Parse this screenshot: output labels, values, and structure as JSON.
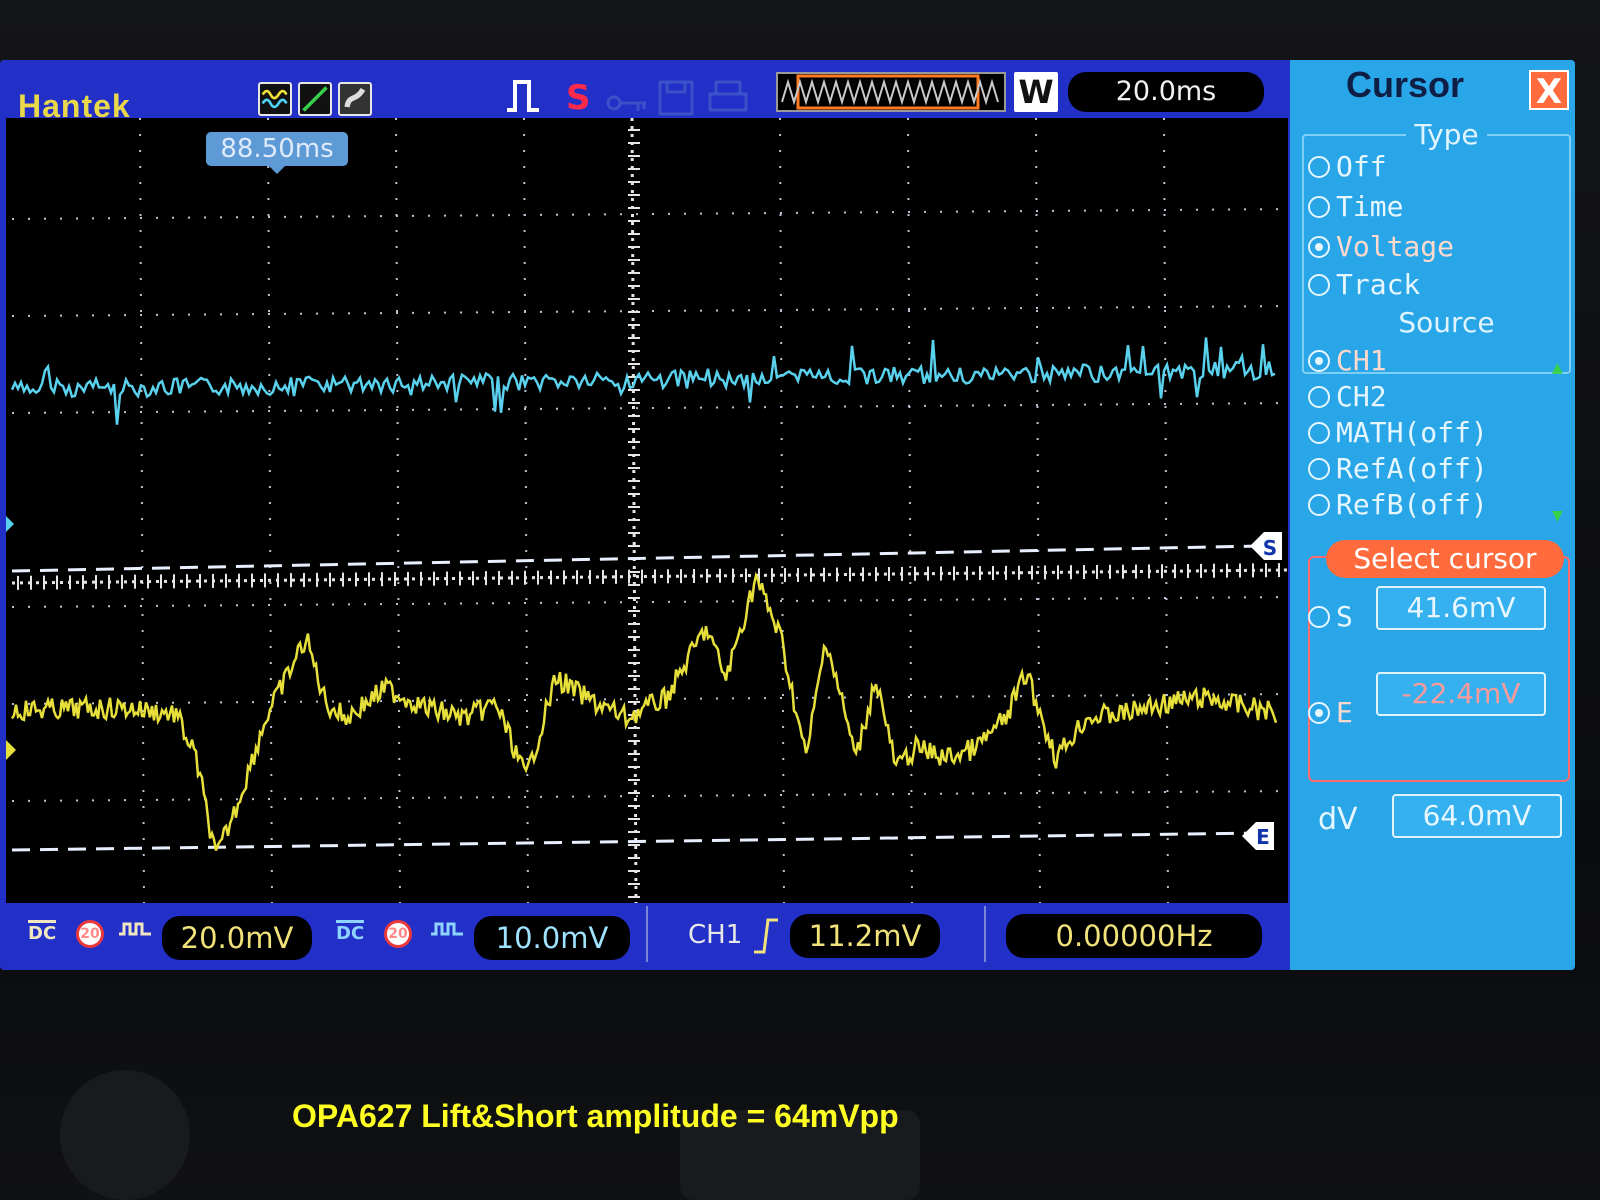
{
  "header": {
    "brand": "Hantek",
    "icons": [
      "wave-mode-icon",
      "line-mode-icon",
      "display-mode-icon",
      "trigger-pulse-icon",
      "stop-icon",
      "key-lock-icon",
      "save-icon",
      "print-icon"
    ],
    "stop_label": "S",
    "window_label": "W",
    "timebase": "20.0ms"
  },
  "display": {
    "time_marker": "88.50ms",
    "cursor_s_tag": "S",
    "cursor_e_tag": "E"
  },
  "bottom": {
    "ch1_coupling": "DC",
    "ch1_bw": "20",
    "ch1_scale": "20.0mV",
    "ch2_coupling": "DC",
    "ch2_bw": "20",
    "ch2_scale": "10.0mV",
    "trigger_source": "CH1",
    "trigger_level": "11.2mV",
    "frequency": "0.00000Hz"
  },
  "panel": {
    "title": "Cursor",
    "close": "X",
    "type_title": "Type",
    "type_options": [
      {
        "label": "Off",
        "selected": false
      },
      {
        "label": "Time",
        "selected": false
      },
      {
        "label": "Voltage",
        "selected": true
      },
      {
        "label": "Track",
        "selected": false
      }
    ],
    "source_title": "Source",
    "source_options": [
      {
        "label": "CH1",
        "selected": true
      },
      {
        "label": "CH2",
        "selected": false
      },
      {
        "label": "MATH(off)",
        "selected": false
      },
      {
        "label": "RefA(off)",
        "selected": false
      },
      {
        "label": "RefB(off)",
        "selected": false
      }
    ],
    "select_cursor": "Select cursor",
    "s_label": "S",
    "s_value": "41.6mV",
    "e_label": "E",
    "e_value": "-22.4mV",
    "selected_cursor": "E",
    "dv_label": "dV",
    "dv_value": "64.0mV"
  },
  "colors": {
    "ch1": "#e8e03a",
    "ch2": "#5ad2ee",
    "screen_frame": "#2230c8",
    "panel": "#29a6e8",
    "accent": "#ff6b3d"
  },
  "caption": "OPA627 Lift&Short amplitude = 64mVpp"
}
